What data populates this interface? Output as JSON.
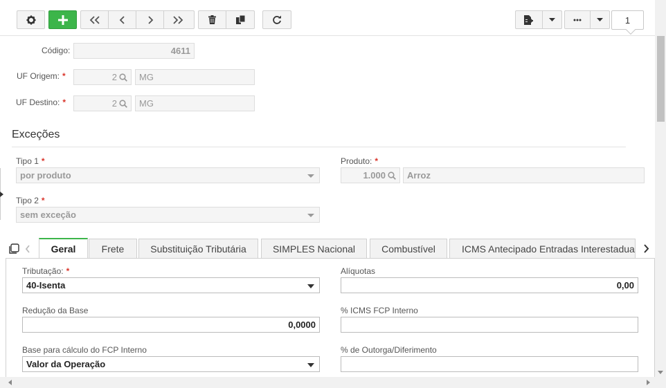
{
  "toolbar": {
    "page_number": "1",
    "icons": [
      "gear-icon",
      "plus-icon",
      "first-page-icon",
      "previous-icon",
      "next-icon",
      "last-page-icon",
      "trash-icon",
      "copy-icon",
      "refresh-icon",
      "report-icon",
      "caret-down-icon",
      "more-icon"
    ]
  },
  "form": {
    "codigo_label": "Código:",
    "codigo_value": "4611",
    "uf_origem_label": "UF Origem:",
    "uf_origem_code": "2",
    "uf_origem_name": "MG",
    "uf_destino_label": "UF Destino:",
    "uf_destino_code": "2",
    "uf_destino_name": "MG",
    "required_mark": "*"
  },
  "excecoes": {
    "title": "Exceções",
    "tipo1_label": "Tipo 1",
    "tipo1_value": "por produto",
    "tipo2_label": "Tipo 2",
    "tipo2_value": "sem exceção",
    "produto_label": "Produto:",
    "produto_code": "1.000",
    "produto_name": "Arroz"
  },
  "tabs": [
    {
      "label": "Geral",
      "active": true
    },
    {
      "label": "Frete"
    },
    {
      "label": "Substituição Tributária"
    },
    {
      "label": "SIMPLES Nacional"
    },
    {
      "label": "Combustível"
    },
    {
      "label": "ICMS Antecipado Entradas Interestaduais"
    }
  ],
  "geral": {
    "tributacao_label": "Tributação:",
    "tributacao_value": "40-Isenta",
    "aliquotas_label": "Alíquotas",
    "aliquotas_value": "0,00",
    "reducao_label": "Redução da Base",
    "reducao_value": "0,0000",
    "icms_fcp_label": "% ICMS FCP Interno",
    "icms_fcp_value": "",
    "base_fcp_label": "Base para cálculo do FCP Interno",
    "base_fcp_value": "Valor da Operação",
    "outorga_label": "% de Outorga/Diferimento",
    "outorga_value": ""
  },
  "colors": {
    "accent_green": "#3cb54a",
    "required_red": "#d9352b"
  }
}
